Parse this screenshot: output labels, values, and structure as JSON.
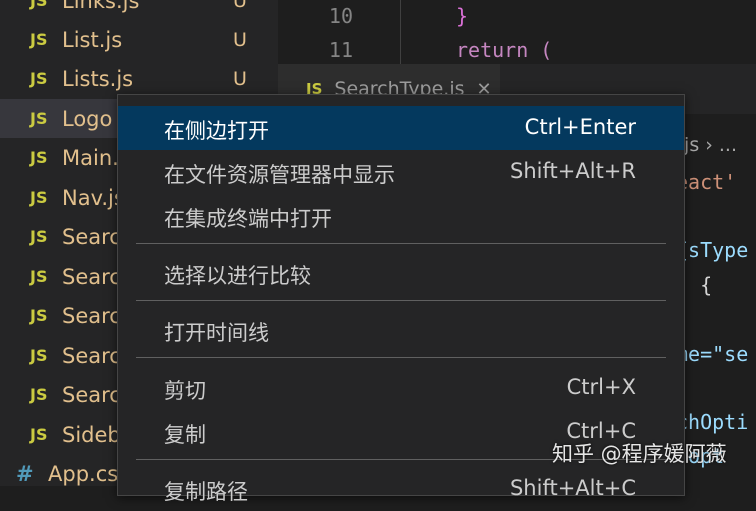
{
  "explorer": {
    "files": [
      {
        "icon": "JS",
        "name": "Links.js",
        "status": "U"
      },
      {
        "icon": "JS",
        "name": "List.js",
        "status": "U"
      },
      {
        "icon": "JS",
        "name": "Lists.js",
        "status": "U"
      },
      {
        "icon": "JS",
        "name": "Logo",
        "status": ""
      },
      {
        "icon": "JS",
        "name": "Main.",
        "status": ""
      },
      {
        "icon": "JS",
        "name": "Nav.js",
        "status": ""
      },
      {
        "icon": "JS",
        "name": "Searc",
        "status": ""
      },
      {
        "icon": "JS",
        "name": "Searc",
        "status": ""
      },
      {
        "icon": "JS",
        "name": "Searc",
        "status": ""
      },
      {
        "icon": "JS",
        "name": "Searc",
        "status": ""
      },
      {
        "icon": "JS",
        "name": "Searc",
        "status": ""
      },
      {
        "icon": "JS",
        "name": "Sideb",
        "status": ""
      },
      {
        "icon": "#",
        "name": "App.cs",
        "status": ""
      }
    ]
  },
  "editor": {
    "top_lines": [
      {
        "number": "10",
        "code": "}"
      },
      {
        "number": "11",
        "code": "return ("
      }
    ],
    "tab": {
      "icon": "JS",
      "name": "SearchType.js",
      "close": "✕"
    },
    "breadcrumb": ".js › ...",
    "code_fragments": [
      {
        "text": "eact'",
        "color": "#ce9178"
      },
      {
        "text": "{sType",
        "color": "#9cdcfe"
      },
      {
        "text": "› {",
        "color": "#d4d4d4"
      },
      {
        "text": "me=\"se",
        "color": "#9cdcfe"
      },
      {
        "text": "chOpti",
        "color": "#9cdcfe"
      },
      {
        "text": "(opt",
        "color": "#9cdcfe"
      }
    ]
  },
  "context_menu": {
    "groups": [
      [
        {
          "label": "在侧边打开",
          "shortcut": "Ctrl+Enter",
          "highlighted": true
        },
        {
          "label": "在文件资源管理器中显示",
          "shortcut": "Shift+Alt+R"
        },
        {
          "label": "在集成终端中打开",
          "shortcut": ""
        }
      ],
      [
        {
          "label": "选择以进行比较",
          "shortcut": ""
        }
      ],
      [
        {
          "label": "打开时间线",
          "shortcut": ""
        }
      ],
      [
        {
          "label": "剪切",
          "shortcut": "Ctrl+X"
        },
        {
          "label": "复制",
          "shortcut": "Ctrl+C"
        }
      ],
      [
        {
          "label": "复制路径",
          "shortcut": "Shift+Alt+C"
        }
      ]
    ]
  },
  "watermark": "知乎 @程序媛阿薇",
  "colors": {
    "menu_highlight": "#04395e",
    "js_icon": "#cbcb41",
    "untracked_file": "#e2c08d",
    "css_icon": "#519aba"
  }
}
